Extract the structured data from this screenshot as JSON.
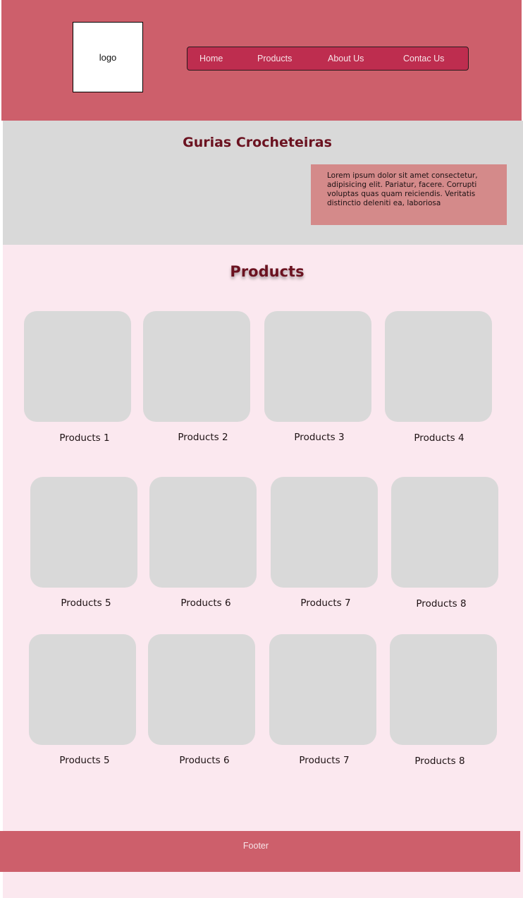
{
  "header": {
    "logo_text": "logo",
    "nav": [
      "Home",
      "Products",
      "About Us",
      "Contac Us"
    ]
  },
  "hero": {
    "title": "Gurias Crocheteiras",
    "text": "Lorem ipsum dolor sit amet consectetur, adipisicing elit. Pariatur, facere. Corrupti voluptas quas quam reiciendis. Veritatis distinctio deleniti ea, laboriosa"
  },
  "products": {
    "title": "Products",
    "items": [
      "Products 1",
      "Products 2",
      "Products 3",
      "Products 4",
      "Products 5",
      "Products 6",
      "Products 7",
      "Products 8",
      "Products 5",
      "Products 6",
      "Products 7",
      "Products 8"
    ]
  },
  "footer": {
    "text": "Footer"
  },
  "colors": {
    "header_bg": "#cd5f6b",
    "nav_bg": "#be2d4f",
    "hero_bg": "#d9d9d9",
    "hero_box_bg": "#d48a8a",
    "products_bg": "#fbe8ef",
    "title_color": "#6b1220"
  }
}
